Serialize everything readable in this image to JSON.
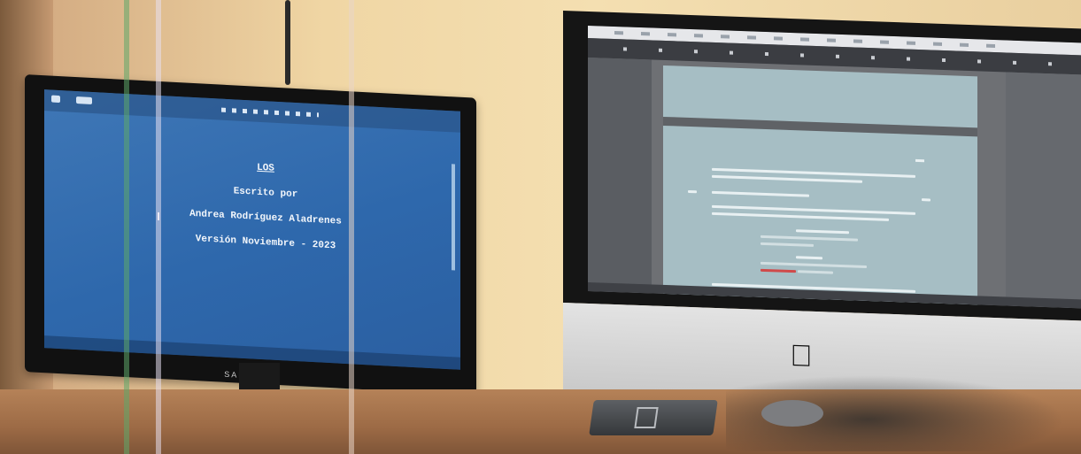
{
  "samsung_monitor": {
    "brand_label": "SAMSUNG",
    "screenplay_title_page": {
      "title": "LOS",
      "written_by": "Escrito por",
      "author": "Andrea Rodríguez Aladrenes",
      "version": "Versión Noviembre - 2023"
    },
    "screen_color": "#2f6aae"
  },
  "imac": {
    "logo": "apple-logo",
    "screen_background": "#6e7074",
    "page_color": "#a6bec4"
  },
  "colors": {
    "wall": "#f0d6a4",
    "desk": "#9c6a45"
  }
}
